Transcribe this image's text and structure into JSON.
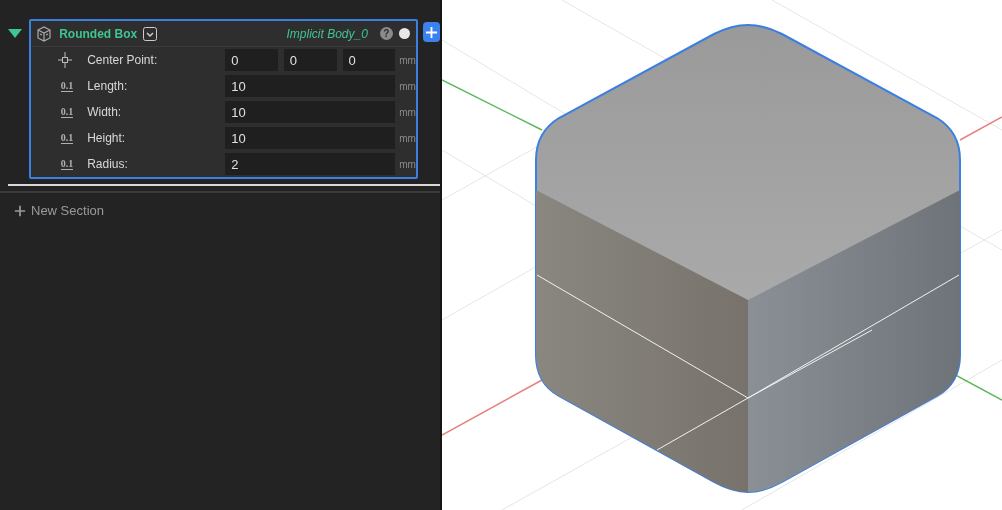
{
  "node": {
    "expanded": true,
    "title": "Rounded Box",
    "body_name": "Implicit Body_0",
    "help": "?",
    "fields": [
      {
        "kind": "vector",
        "label": "Center Point:",
        "values": [
          "0",
          "0",
          "0"
        ],
        "unit": "mm"
      },
      {
        "kind": "scalar",
        "badge": "0.1",
        "label": "Length:",
        "values": [
          "10"
        ],
        "unit": "mm"
      },
      {
        "kind": "scalar",
        "badge": "0.1",
        "label": "Width:",
        "values": [
          "10"
        ],
        "unit": "mm"
      },
      {
        "kind": "scalar",
        "badge": "0.1",
        "label": "Height:",
        "values": [
          "10"
        ],
        "unit": "mm"
      },
      {
        "kind": "scalar",
        "badge": "0.1",
        "label": "Radius:",
        "values": [
          "2"
        ],
        "unit": "mm"
      }
    ]
  },
  "new_section": "New Section"
}
